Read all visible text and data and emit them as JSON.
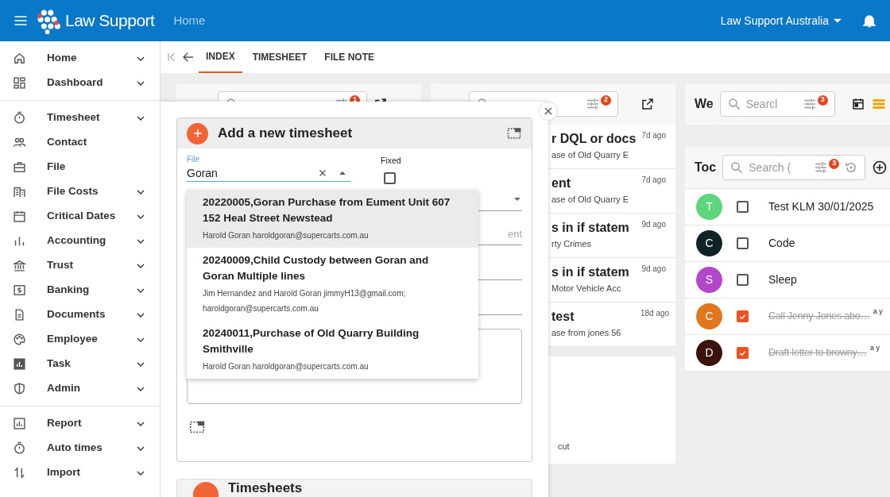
{
  "topbar": {
    "brand": "Law Support",
    "page": "Home",
    "org": "Law Support Australia"
  },
  "sidebar": {
    "groups": [
      [
        {
          "label": "Home",
          "expandable": true
        },
        {
          "label": "Dashboard",
          "expandable": true
        }
      ],
      [
        {
          "label": "Timesheet",
          "expandable": true
        },
        {
          "label": "Contact",
          "expandable": false
        },
        {
          "label": "File",
          "expandable": false
        },
        {
          "label": "File Costs",
          "expandable": true
        },
        {
          "label": "Critical Dates",
          "expandable": true
        },
        {
          "label": "Accounting",
          "expandable": true
        },
        {
          "label": "Trust",
          "expandable": true
        },
        {
          "label": "Banking",
          "expandable": true
        },
        {
          "label": "Documents",
          "expandable": true
        },
        {
          "label": "Employee",
          "expandable": true
        },
        {
          "label": "Task",
          "expandable": true
        },
        {
          "label": "Admin",
          "expandable": true
        }
      ],
      [
        {
          "label": "Report",
          "expandable": true
        },
        {
          "label": "Auto times",
          "expandable": true
        },
        {
          "label": "Import",
          "expandable": true
        }
      ]
    ]
  },
  "tabs": [
    {
      "label": "INDEX",
      "selected": true
    },
    {
      "label": "TIMESHEET",
      "selected": false
    },
    {
      "label": "FILE NOTE",
      "selected": false
    }
  ],
  "files_panel": {
    "filter_count": "1"
  },
  "notes_panel": {
    "filter_count": "2",
    "items": [
      {
        "title": "r DQL or docs",
        "subtitle": "ase of Old Quarry E",
        "time": "7d ago"
      },
      {
        "title": "ent",
        "subtitle": "ase of Old Quarry E",
        "time": "7d ago"
      },
      {
        "title": "s in if statem",
        "subtitle": "rty Crimes",
        "time": "9d ago"
      },
      {
        "title": "s in if statem",
        "subtitle": "Motor Vehicle Acc",
        "time": "9d ago"
      },
      {
        "title": "test",
        "subtitle": "ase from jones 56",
        "time": "18d ago"
      }
    ],
    "footer_text": "cut"
  },
  "week_panel": {
    "title": "We",
    "search_placeholder": "Searcl",
    "filter_count": "3"
  },
  "todo_panel": {
    "title": "Toc",
    "search_placeholder": "Search (",
    "filter_count": "3",
    "items": [
      {
        "initial": "T",
        "color": "#5ed47c",
        "checked": false,
        "text": "Test KLM 30/01/2025"
      },
      {
        "initial": "C",
        "color": "#0e2426",
        "checked": false,
        "text": "Code"
      },
      {
        "initial": "S",
        "color": "#b347c9",
        "checked": false,
        "text": "Sleep"
      },
      {
        "initial": "C",
        "color": "#e1761e",
        "checked": true,
        "text": "Call Jenny Jones abo…",
        "meta": "a y"
      },
      {
        "initial": "D",
        "color": "#3b130b",
        "checked": true,
        "text": "Draft letter to browny…",
        "meta": "a y"
      }
    ]
  },
  "dialog": {
    "title": "Add a new timesheet",
    "file_label": "File",
    "file_value": "Goran",
    "fixed_label": "Fixed",
    "fixed_checked": false,
    "hidden_field_placeholder": "ent",
    "options": [
      {
        "title": "20220005,Goran Purchase from Eument Unit 607 152 Heal Street Newstead",
        "detail": "Harold Goran haroldgoran@supercarts.com.au",
        "selected": true
      },
      {
        "title": "20240009,Child Custody between Goran and Goran Multiple lines",
        "detail": "Jim Hernandez and Harold Goran jimmyH13@gmail.com; haroldgoran@supercarts.com.au",
        "selected": false
      },
      {
        "title": "20240011,Purchase of Old Quarry Building Smithville",
        "detail": "Harold Goran haroldgoran@supercarts.com.au",
        "selected": false
      }
    ]
  },
  "timesheets_card": {
    "title": "Timesheets"
  }
}
